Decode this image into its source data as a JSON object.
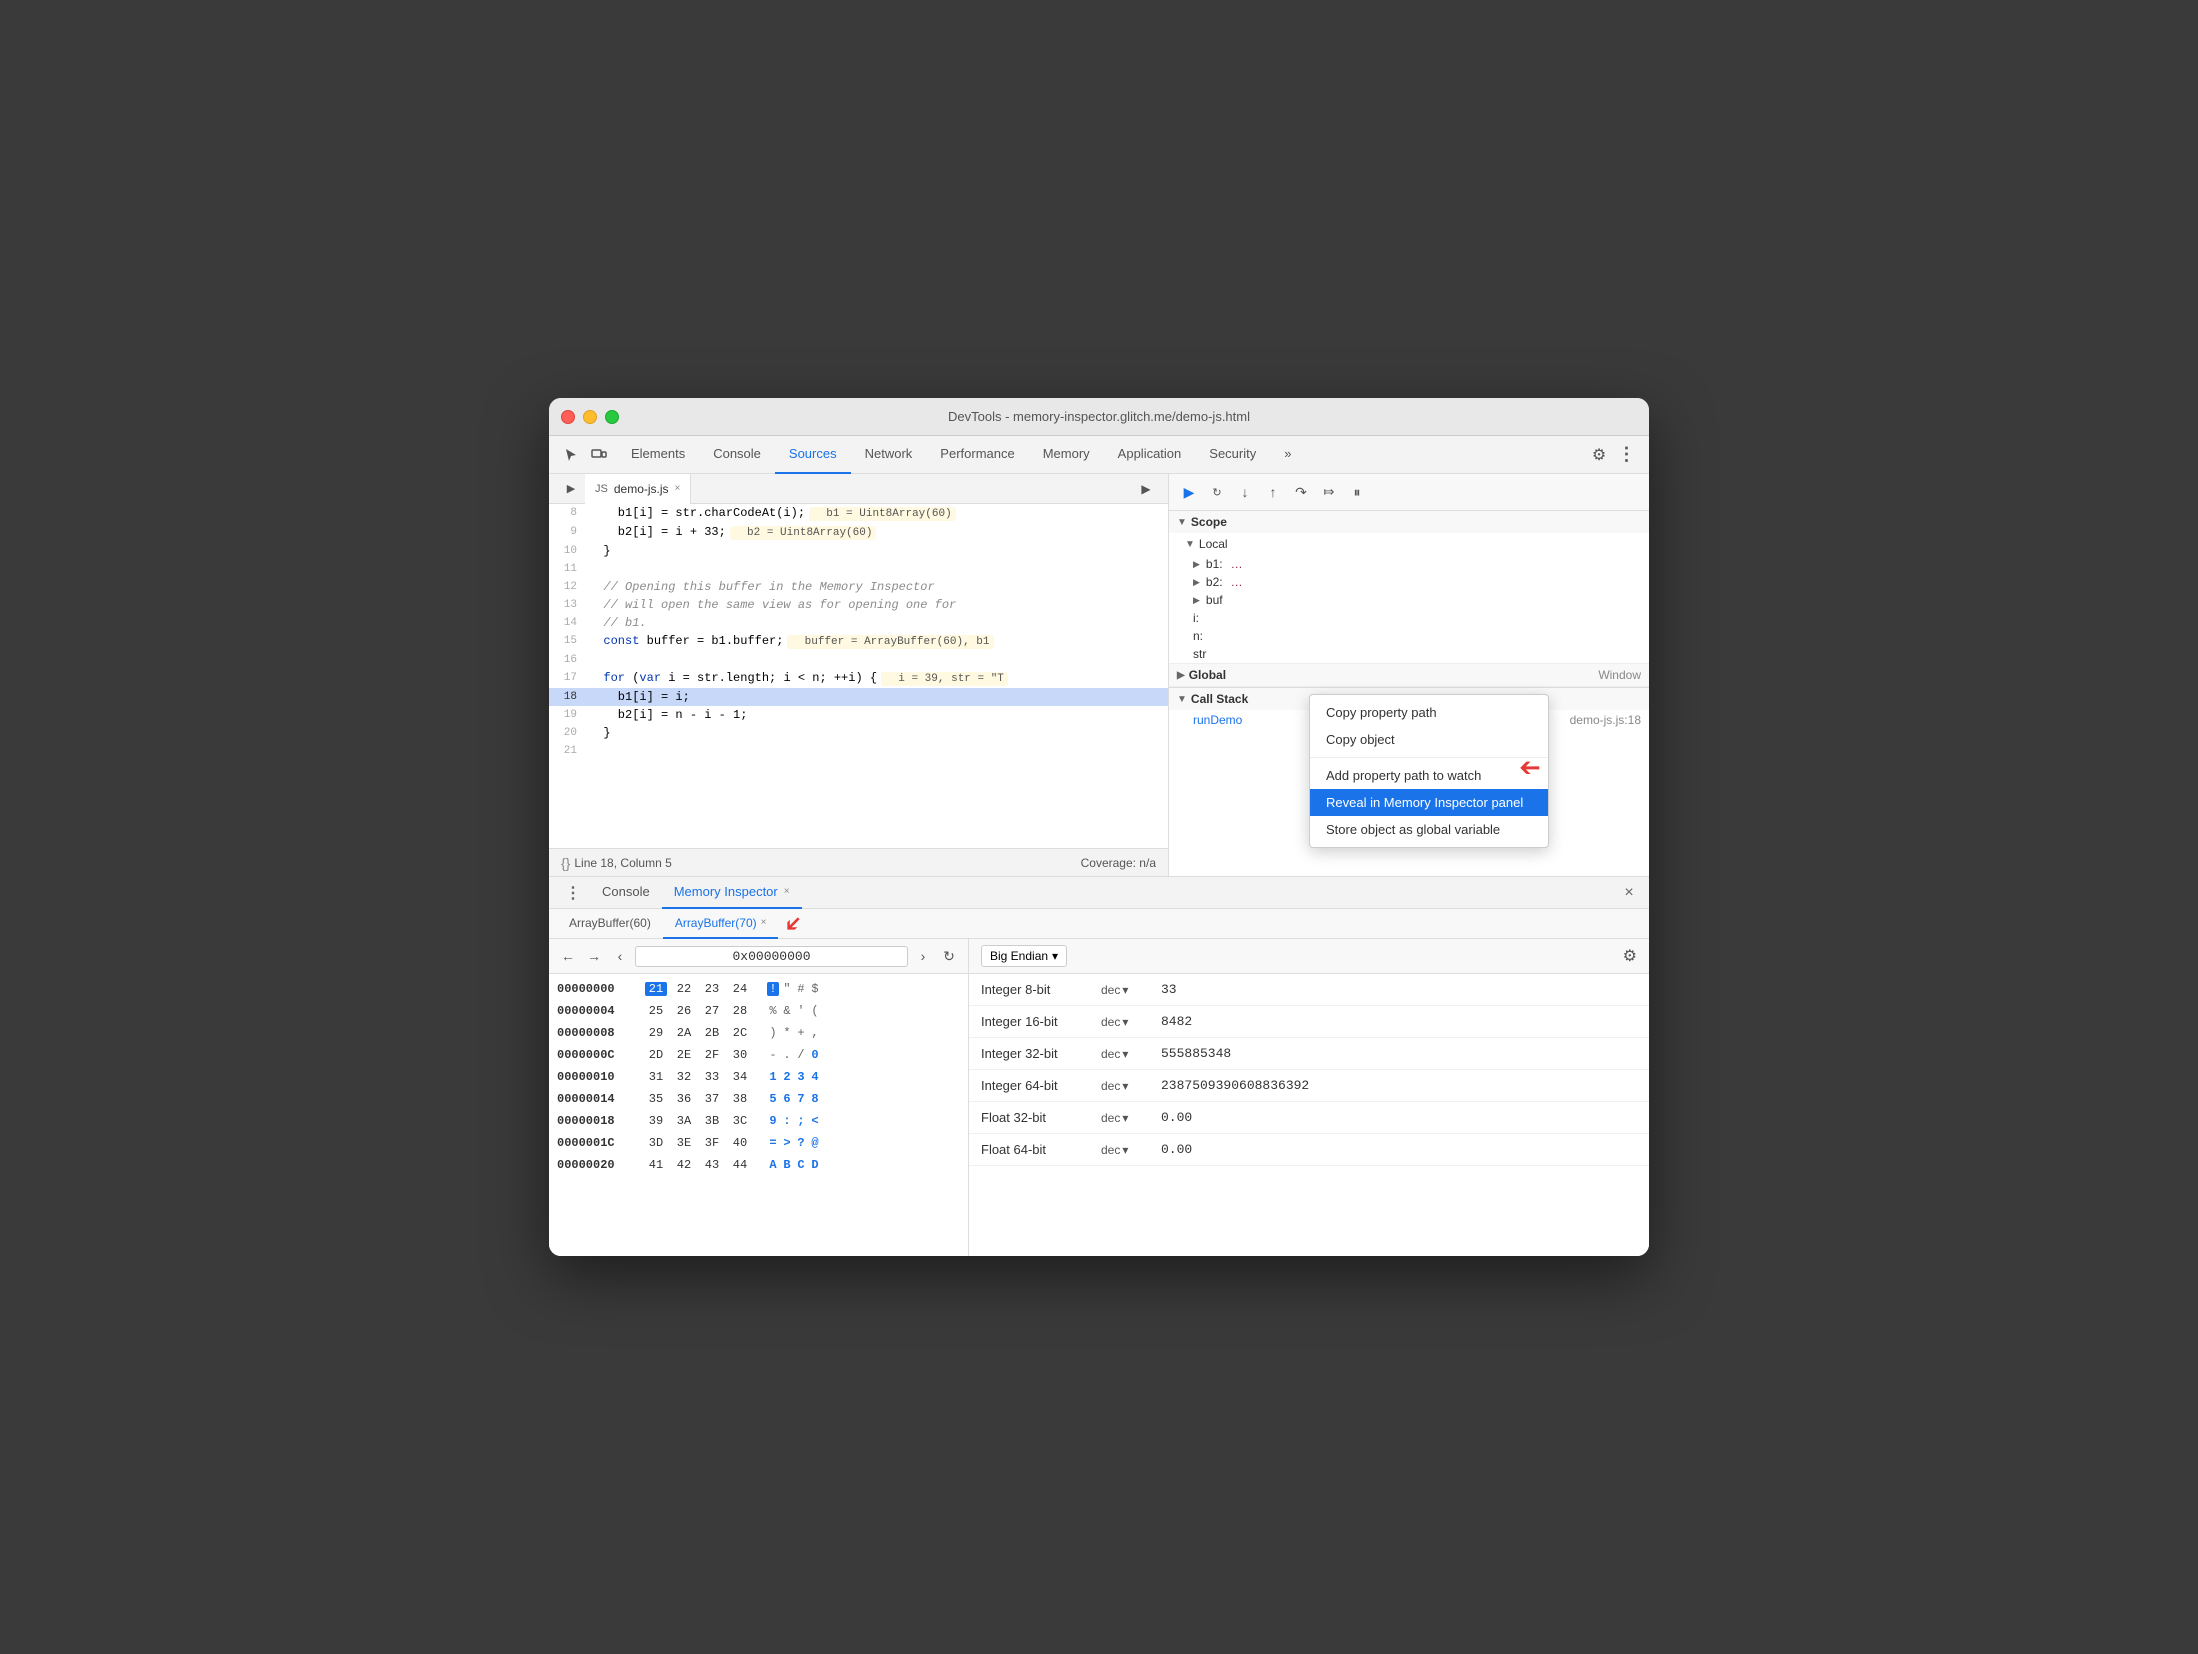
{
  "window": {
    "title": "DevTools - memory-inspector.glitch.me/demo-js.html"
  },
  "nav": {
    "tabs": [
      "Elements",
      "Console",
      "Sources",
      "Network",
      "Performance",
      "Memory",
      "Application",
      "Security"
    ],
    "active_tab": "Sources",
    "more_label": "»"
  },
  "source_file": {
    "name": "demo-js.js",
    "lines": [
      {
        "num": "8",
        "content": "    b1[i] = str.charCodeAt(i);",
        "inline": "b1 = Uint8Array(60)",
        "inline_type": "yellow"
      },
      {
        "num": "9",
        "content": "    b2[i] = i + 33;",
        "inline": "b2 = Uint8Array(60)",
        "inline_type": "yellow"
      },
      {
        "num": "10",
        "content": "  }",
        "inline": ""
      },
      {
        "num": "11",
        "content": ""
      },
      {
        "num": "12",
        "content": "  // Opening this buffer in the Memory Inspector",
        "type": "comment"
      },
      {
        "num": "13",
        "content": "  // will open the same view as for opening one for",
        "type": "comment"
      },
      {
        "num": "14",
        "content": "  // b1.",
        "type": "comment"
      },
      {
        "num": "15",
        "content": "  const buffer = b1.buffer;",
        "inline": "buffer = ArrayBuffer(60), b1",
        "inline_type": "yellow"
      },
      {
        "num": "16",
        "content": ""
      },
      {
        "num": "17",
        "content": "  for (var i = str.length; i < n; ++i) {",
        "inline": "i = 39, str = \"T",
        "inline_type": "yellow"
      },
      {
        "num": "18",
        "content": "    b1[i] = i;",
        "active": true
      },
      {
        "num": "19",
        "content": "    b2[i] = n - i - 1;"
      },
      {
        "num": "20",
        "content": "  }"
      },
      {
        "num": "21",
        "content": ""
      }
    ]
  },
  "status_bar": {
    "line_col": "Line 18, Column 5",
    "coverage": "Coverage: n/a"
  },
  "debug_toolbar": {
    "buttons": [
      "▶",
      "↺",
      "↓",
      "↑",
      "↷",
      "⇒",
      "⏸"
    ]
  },
  "scope": {
    "title": "Scope",
    "local_title": "Local",
    "items": [
      {
        "name": "b1:",
        "val": "…"
      },
      {
        "name": "b2:",
        "val": "…"
      },
      {
        "name": "buf",
        "val": ""
      },
      {
        "name": "i:",
        "val": ""
      },
      {
        "name": "n:",
        "val": ""
      },
      {
        "name": "str",
        "val": ""
      }
    ],
    "global_title": "Global",
    "global_val": "Window"
  },
  "context_menu": {
    "items": [
      {
        "label": "Copy property path",
        "id": "copy-prop-path"
      },
      {
        "label": "Copy object",
        "id": "copy-object"
      },
      {
        "separator": true
      },
      {
        "label": "Add property path to watch",
        "id": "add-to-watch"
      },
      {
        "label": "Reveal in Memory Inspector panel",
        "id": "reveal-memory",
        "highlighted": true
      },
      {
        "label": "Store object as global variable",
        "id": "store-global"
      }
    ]
  },
  "call_stack": {
    "title": "Call Stack",
    "items": [
      {
        "fn": "runDemo",
        "loc": "demo-js.js:18"
      }
    ]
  },
  "bottom_panel": {
    "tabs": [
      "Console",
      "Memory Inspector"
    ],
    "active_tab": "Memory Inspector",
    "close_label": "×"
  },
  "mem_subtabs": {
    "tabs": [
      "ArrayBuffer(60)",
      "ArrayBuffer(70)"
    ],
    "active_tab": "ArrayBuffer(70)"
  },
  "hex_viewer": {
    "address": "0x00000000",
    "rows": [
      {
        "addr": "00000000",
        "bytes": [
          "21",
          "22",
          "23",
          "24"
        ],
        "chars": [
          "!",
          "\"",
          "#",
          "$"
        ],
        "selected": 0
      },
      {
        "addr": "00000004",
        "bytes": [
          "25",
          "26",
          "27",
          "28"
        ],
        "chars": [
          "%",
          "&",
          "'",
          "("
        ]
      },
      {
        "addr": "00000008",
        "bytes": [
          "29",
          "2A",
          "2B",
          "2C"
        ],
        "chars": [
          ")",
          "*",
          "+",
          ","
        ]
      },
      {
        "addr": "0000000C",
        "bytes": [
          "2D",
          "2E",
          "2F",
          "30"
        ],
        "chars": [
          "-",
          ".",
          "/",
          "0"
        ],
        "blue_chars": [
          3
        ]
      },
      {
        "addr": "00000010",
        "bytes": [
          "31",
          "32",
          "33",
          "34"
        ],
        "chars": [
          "1",
          "2",
          "3",
          "4"
        ],
        "blue_chars_all": true
      },
      {
        "addr": "00000014",
        "bytes": [
          "35",
          "36",
          "37",
          "38"
        ],
        "chars": [
          "5",
          "6",
          "7",
          "8"
        ],
        "blue_chars_all": true
      },
      {
        "addr": "00000018",
        "bytes": [
          "39",
          "3A",
          "3B",
          "3C"
        ],
        "chars": [
          "9",
          ":",
          ";",
          "<"
        ],
        "blue_chars_all": true
      },
      {
        "addr": "0000001C",
        "bytes": [
          "3D",
          "3E",
          "3F",
          "40"
        ],
        "chars": [
          "=",
          ">",
          "?",
          "@"
        ],
        "blue_chars_all": true
      },
      {
        "addr": "00000020",
        "bytes": [
          "41",
          "42",
          "43",
          "44"
        ],
        "chars": [
          "A",
          "B",
          "C",
          "D"
        ],
        "blue_chars_all": true
      }
    ]
  },
  "data_interpreter": {
    "endian": "Big Endian",
    "rows": [
      {
        "label": "Integer 8-bit",
        "format": "dec",
        "value": "33"
      },
      {
        "label": "Integer 16-bit",
        "format": "dec",
        "value": "8482"
      },
      {
        "label": "Integer 32-bit",
        "format": "dec",
        "value": "555885348"
      },
      {
        "label": "Integer 64-bit",
        "format": "dec",
        "value": "2387509390608836392"
      },
      {
        "label": "Float 32-bit",
        "format": "dec",
        "value": "0.00"
      },
      {
        "label": "Float 64-bit",
        "format": "dec",
        "value": "0.00"
      }
    ]
  }
}
